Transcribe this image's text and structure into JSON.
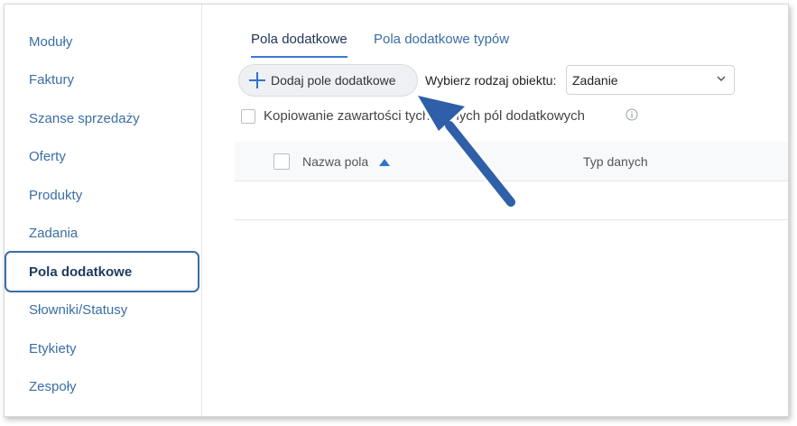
{
  "sidebar": {
    "items": [
      {
        "label": "Moduły"
      },
      {
        "label": "Faktury"
      },
      {
        "label": "Szanse sprzedaży"
      },
      {
        "label": "Oferty"
      },
      {
        "label": "Produkty"
      },
      {
        "label": "Zadania"
      },
      {
        "label": "Pola dodatkowe"
      },
      {
        "label": "Słowniki/Statusy"
      },
      {
        "label": "Etykiety"
      },
      {
        "label": "Zespoły"
      }
    ],
    "active_index": 6
  },
  "tabs": [
    {
      "label": "Pola dodatkowe"
    },
    {
      "label": "Pola dodatkowe typów"
    }
  ],
  "toolbar": {
    "add_label": "Dodaj pole dodatkowe",
    "object_type_label": "Wybierz rodzaj obiektu:",
    "object_type_value": "Zadanie"
  },
  "copy_option": {
    "label": "Kopiowanie zawartości tych samych pól dodatkowych"
  },
  "table": {
    "columns": [
      "Nazwa pola",
      "Typ danych"
    ]
  },
  "icons": {
    "add": "plus-icon",
    "select": "chevron-down-icon",
    "info": "info-icon",
    "sort": "sort-ascending-icon",
    "callout": "callout-arrow"
  },
  "colors": {
    "accent": "#2f73d0",
    "link": "#3b6ea5",
    "arrow": "#2e5fa8"
  }
}
